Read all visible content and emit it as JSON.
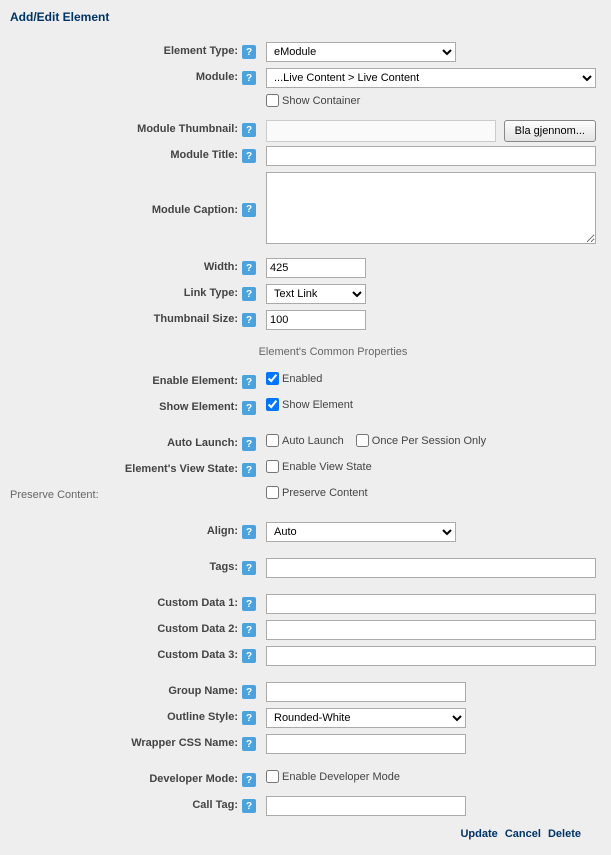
{
  "title": "Add/Edit Element",
  "labels": {
    "elementType": "Element Type:",
    "module": "Module:",
    "showContainer": "Show Container",
    "moduleThumbnail": "Module Thumbnail:",
    "moduleTitle": "Module Title:",
    "moduleCaption": "Module Caption:",
    "width": "Width:",
    "linkType": "Link Type:",
    "thumbnailSize": "Thumbnail Size:",
    "commonProps": "Element's Common Properties",
    "enableElement": "Enable Element:",
    "showElement": "Show Element:",
    "autoLaunch": "Auto Launch:",
    "elementsViewState": "Element's View State:",
    "preserveContent": "Preserve Content:",
    "align": "Align:",
    "tags": "Tags:",
    "customData1": "Custom Data 1:",
    "customData2": "Custom Data 2:",
    "customData3": "Custom Data 3:",
    "groupName": "Group Name:",
    "outlineStyle": "Outline Style:",
    "wrapperCssName": "Wrapper CSS Name:",
    "developerMode": "Developer Mode:",
    "callTag": "Call Tag:"
  },
  "checkboxLabels": {
    "enabled": "Enabled",
    "showElement": "Show Element",
    "autoLaunch": "Auto Launch",
    "oncePerSession": "Once Per Session Only",
    "enableViewState": "Enable View State",
    "preserveContent": "Preserve Content",
    "enableDeveloperMode": "Enable Developer Mode"
  },
  "values": {
    "elementType": "eModule",
    "module": "...Live Content > Live Content",
    "showContainer": false,
    "moduleTitle": "",
    "moduleCaption": "",
    "width": "425",
    "linkType": "Text Link",
    "thumbnailSize": "100",
    "enabled": true,
    "showElement": true,
    "autoLaunch": false,
    "oncePerSession": false,
    "enableViewState": false,
    "preserveContent": false,
    "align": "Auto",
    "tags": "",
    "customData1": "",
    "customData2": "",
    "customData3": "",
    "groupName": "",
    "outlineStyle": "Rounded-White",
    "wrapperCssName": "",
    "developerMode": false,
    "callTag": ""
  },
  "buttons": {
    "browse": "Bla gjennom...",
    "update": "Update",
    "cancel": "Cancel",
    "delete": "Delete"
  },
  "helpGlyph": "?"
}
